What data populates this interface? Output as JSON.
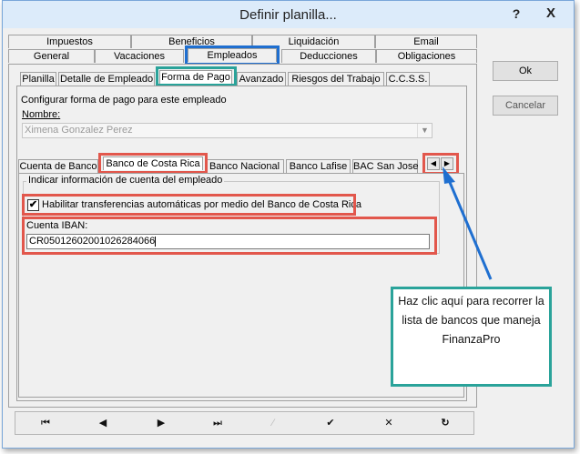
{
  "window": {
    "title": "Definir planilla...",
    "help_label": "?",
    "close_label": "X"
  },
  "main_tabs_row1": [
    "Impuestos",
    "Beneficios",
    "Liquidación",
    "Email"
  ],
  "main_tabs_row2": [
    "General",
    "Vacaciones",
    "Empleados",
    "Deducciones",
    "Obligaciones"
  ],
  "sub_tabs": [
    "Planilla",
    "Detalle de Empleado",
    "Forma de Pago",
    "Avanzado",
    "Riesgos del Trabajo",
    "C.C.S.S."
  ],
  "payment": {
    "group_label": "Configurar forma de pago para este empleado",
    "name_label": "Nombre:",
    "name_value": "Ximena Gonzalez Perez"
  },
  "bank_tabs": [
    "Cuenta de Banco",
    "Banco de Costa Rica",
    "Banco Nacional",
    "Banco Lafise",
    "BAC San Jose"
  ],
  "bank_scroll": {
    "left_icon": "◀",
    "right_icon": "▶"
  },
  "account": {
    "group_label": "Indicar información de cuenta del empleado",
    "checkbox_label": "Habilitar transferencias automáticas por medio del Banco de Costa Rica",
    "checkbox_checked": "✔",
    "iban_label": "Cuenta IBAN:",
    "iban_value": "CR05012602001026284066"
  },
  "buttons": {
    "ok": "Ok",
    "cancel": "Cancelar"
  },
  "navbar": [
    "⏮",
    "◀",
    "▶",
    "⏭",
    "∕",
    "✔",
    "✕",
    "↻"
  ],
  "callout": {
    "text": "Haz clic aquí para recorrer la lista de bancos que maneja FinanzaPro"
  },
  "colors": {
    "accent_blue": "#1f6fd0",
    "accent_green": "#2aa39a",
    "accent_red": "#e2574c"
  }
}
